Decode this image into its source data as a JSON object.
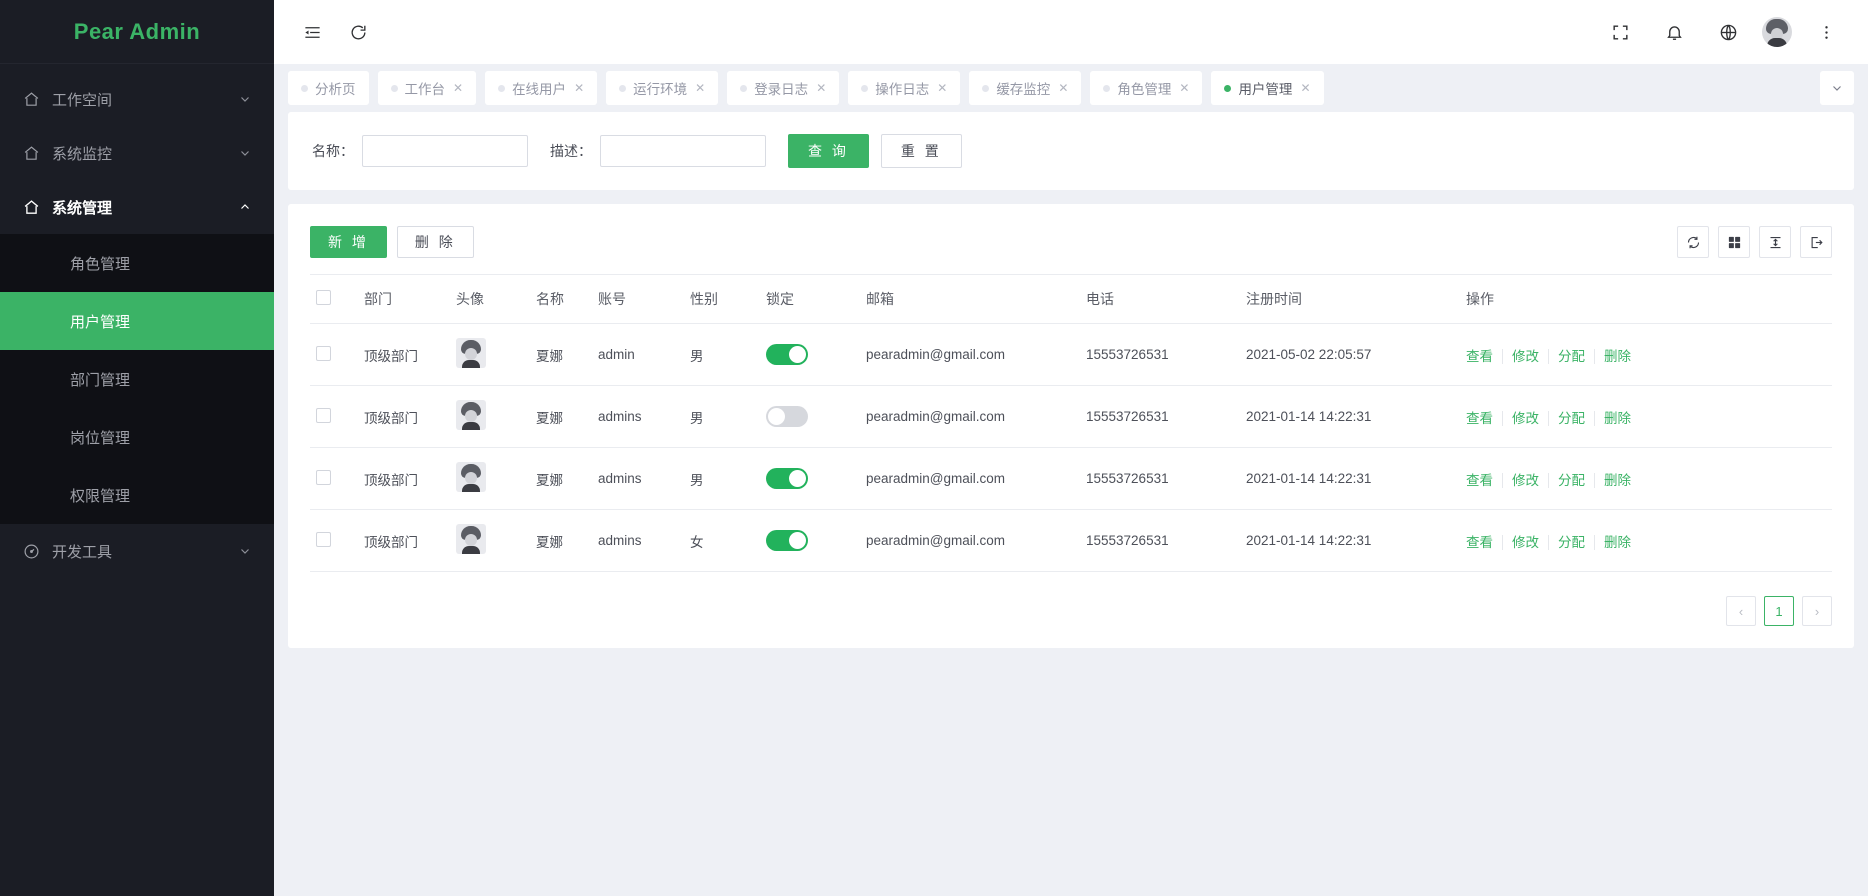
{
  "brand": {
    "title": "Pear Admin"
  },
  "sidebar": {
    "groups": [
      {
        "label": "工作空间",
        "icon": "home-icon",
        "open": false
      },
      {
        "label": "系统监控",
        "icon": "home-icon",
        "open": false
      },
      {
        "label": "系统管理",
        "icon": "home-icon",
        "open": true
      },
      {
        "label": "开发工具",
        "icon": "dashboard-icon",
        "open": false
      }
    ],
    "submenu": [
      {
        "label": "角色管理",
        "active": false
      },
      {
        "label": "用户管理",
        "active": true
      },
      {
        "label": "部门管理",
        "active": false
      },
      {
        "label": "岗位管理",
        "active": false
      },
      {
        "label": "权限管理",
        "active": false
      }
    ]
  },
  "header": {
    "left_icons": [
      {
        "name": "menu-collapse-icon"
      },
      {
        "name": "refresh-icon"
      }
    ],
    "right_icons": [
      {
        "name": "fullscreen-icon"
      },
      {
        "name": "bell-icon"
      },
      {
        "name": "globe-icon"
      }
    ],
    "more_icon": "more-vertical-icon"
  },
  "tabs": [
    {
      "label": "分析页",
      "closable": false,
      "active": false
    },
    {
      "label": "工作台",
      "closable": true,
      "active": false
    },
    {
      "label": "在线用户",
      "closable": true,
      "active": false
    },
    {
      "label": "运行环境",
      "closable": true,
      "active": false
    },
    {
      "label": "登录日志",
      "closable": true,
      "active": false
    },
    {
      "label": "操作日志",
      "closable": true,
      "active": false
    },
    {
      "label": "缓存监控",
      "closable": true,
      "active": false
    },
    {
      "label": "角色管理",
      "closable": true,
      "active": false
    },
    {
      "label": "用户管理",
      "closable": true,
      "active": true
    }
  ],
  "tab_close_glyph": "✕",
  "search": {
    "name_label": "名称：",
    "name_value": "",
    "name_placeholder": "",
    "desc_label": "描述：",
    "desc_value": "",
    "desc_placeholder": "",
    "query_button": "查 询",
    "reset_button": "重 置"
  },
  "toolbar": {
    "add_button": "新 增",
    "delete_button": "删 除",
    "tools": [
      {
        "name": "refresh-table-icon"
      },
      {
        "name": "column-filter-icon"
      },
      {
        "name": "row-height-icon"
      },
      {
        "name": "export-icon"
      }
    ]
  },
  "table": {
    "columns": [
      "",
      "部门",
      "头像",
      "名称",
      "账号",
      "性别",
      "锁定",
      "邮箱",
      "电话",
      "注册时间",
      "操作"
    ],
    "rows": [
      {
        "dept": "顶级部门",
        "name": "夏娜",
        "account": "admin",
        "gender": "男",
        "locked": true,
        "email": "pearadmin@gmail.com",
        "phone": "15553726531",
        "created": "2021-05-02 22:05:57"
      },
      {
        "dept": "顶级部门",
        "name": "夏娜",
        "account": "admins",
        "gender": "男",
        "locked": false,
        "email": "pearadmin@gmail.com",
        "phone": "15553726531",
        "created": "2021-01-14 14:22:31"
      },
      {
        "dept": "顶级部门",
        "name": "夏娜",
        "account": "admins",
        "gender": "男",
        "locked": true,
        "email": "pearadmin@gmail.com",
        "phone": "15553726531",
        "created": "2021-01-14 14:22:31"
      },
      {
        "dept": "顶级部门",
        "name": "夏娜",
        "account": "admins",
        "gender": "女",
        "locked": true,
        "email": "pearadmin@gmail.com",
        "phone": "15553726531",
        "created": "2021-01-14 14:22:31"
      }
    ],
    "actions": [
      "查看",
      "修改",
      "分配",
      "删除"
    ]
  },
  "pagination": {
    "prev": "‹",
    "next": "›",
    "pages": [
      "1"
    ],
    "current": "1"
  },
  "colors": {
    "accent": "#3bb366",
    "switch_on": "#22b25c",
    "switch_off": "#d6d8dd",
    "sidebar_bg": "#1b1d25",
    "submenu_bg": "#0f1015",
    "page_bg": "#eef0f5"
  }
}
